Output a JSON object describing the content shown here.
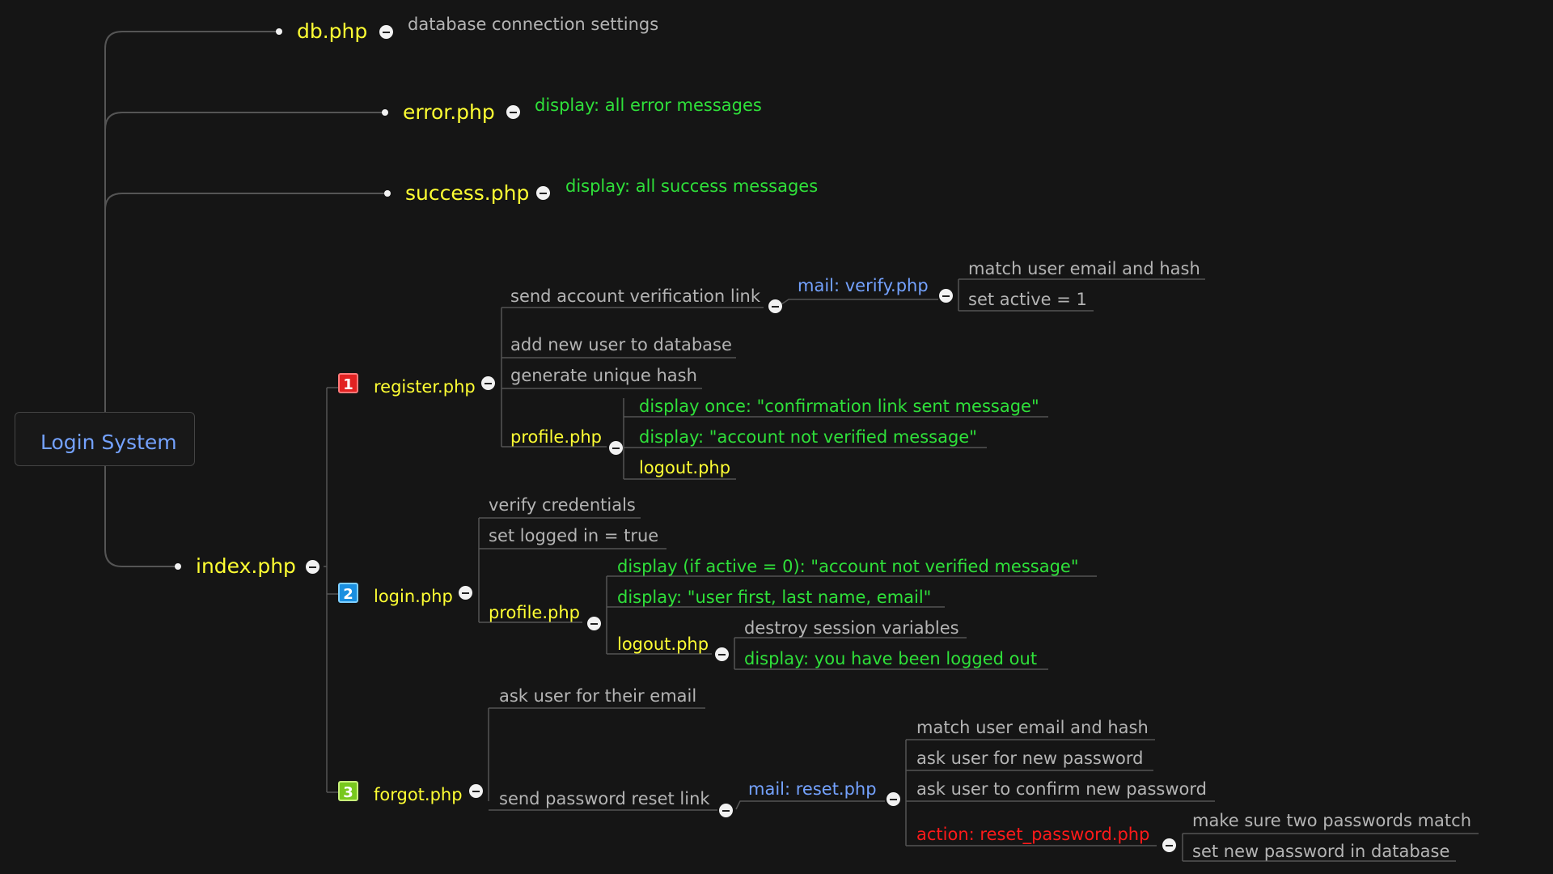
{
  "root": {
    "label": "Login System"
  },
  "db": {
    "file": "db.php",
    "note": "database connection settings"
  },
  "error": {
    "file": "error.php",
    "note": "display: all error messages"
  },
  "success": {
    "file": "success.php",
    "note": "display: all success messages"
  },
  "index": {
    "file": "index.php"
  },
  "register": {
    "badge": "1",
    "file": "register.php",
    "send_link": "send account verification link",
    "mail": "mail: verify.php",
    "match": "match user email and hash",
    "set_active": "set active = 1",
    "add_user": "add new user to database",
    "hash": "generate unique hash",
    "profile": "profile.php",
    "display_once": "display once: \"confirmation link sent message\"",
    "display_not_verified": "display: \"account not verified message\"",
    "logout": "logout.php"
  },
  "login": {
    "badge": "2",
    "file": "login.php",
    "verify": "verify credentials",
    "set_logged": "set logged in = true",
    "profile": "profile.php",
    "display_if": "display (if active = 0): \"account not verified message\"",
    "display_user": "display: \"user first, last name, email\"",
    "logout": "logout.php",
    "destroy": "destroy session variables",
    "logged_out": "display: you have been logged out"
  },
  "forgot": {
    "badge": "3",
    "file": "forgot.php",
    "ask_email": "ask user for their email",
    "send_reset": "send password reset link",
    "mail": "mail: reset.php",
    "match": "match user email and hash",
    "ask_new": "ask user for new password",
    "ask_confirm": "ask user to confirm new password",
    "action": "action: reset_password.php",
    "make_sure": "make sure two passwords match",
    "set_new": "set new password in database"
  },
  "colors": {
    "background": "#151515",
    "file": "#ffff33",
    "display": "#2fe03a",
    "note": "#b4b4b4",
    "mail": "#74a2ff",
    "action": "#ff1a1a",
    "connector": "#555555"
  }
}
